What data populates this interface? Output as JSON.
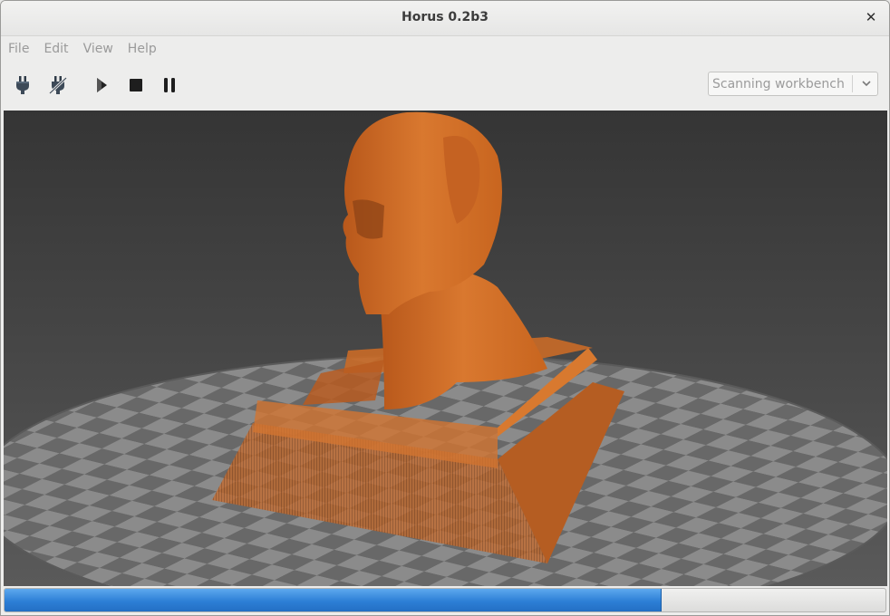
{
  "window": {
    "title": "Horus 0.2b3"
  },
  "menu": {
    "items": [
      "File",
      "Edit",
      "View",
      "Help"
    ]
  },
  "toolbar": {
    "icons": [
      "connect-icon",
      "disconnect-icon",
      "play-icon",
      "stop-icon",
      "pause-icon"
    ],
    "workbench_selected": "Scanning workbench"
  },
  "scene": {
    "model_color": "#d4712a",
    "platform_light": "#8e8e8e",
    "platform_dark": "#6a6a6a",
    "background": "#3c3c3c"
  },
  "progress": {
    "fraction": 0.745,
    "color": "#2d7fd6"
  }
}
